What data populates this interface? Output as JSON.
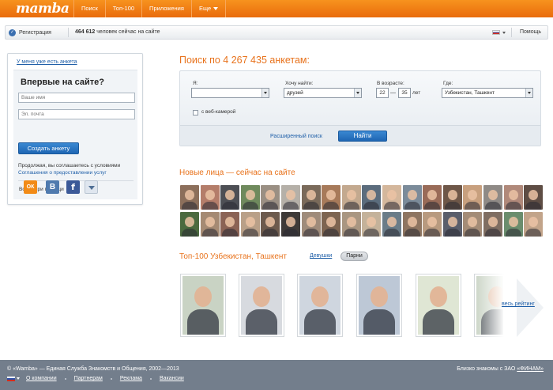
{
  "header": {
    "logo": "mamba",
    "nav": [
      {
        "label": "Поиск"
      },
      {
        "label": "Топ-100"
      },
      {
        "label": "Приложения"
      },
      {
        "label": "Еще"
      }
    ]
  },
  "subbar": {
    "registration": "Регистрация",
    "online_count": "464 612",
    "online_text": " человек сейчас на сайте",
    "help": "Помощь"
  },
  "login": {
    "have_account": "У меня уже есть анкета",
    "title": "Впервые на сайте?",
    "name_placeholder": "Ваше имя",
    "email_placeholder": "Эл. почта",
    "create_button": "Создать анкету",
    "terms_text": "Продолжая, вы соглашаетесь с условиями",
    "terms_link": "Соглашения о предоставлении услуг",
    "login_with": "Войти при помощи",
    "social": {
      "ok": "ОК",
      "vk": "B",
      "fb": "f"
    }
  },
  "search": {
    "title": "Поиск по 4 267 435 анкетам:",
    "i_label": "Я:",
    "i_value": "",
    "want_label": "Хочу найти:",
    "want_value": "друзей",
    "age_label": "В возрасте:",
    "age_from": "22",
    "age_dash": "—",
    "age_to": "35",
    "age_unit": "лет",
    "where_label": "Где:",
    "where_value": "Узбекистан, Ташкент",
    "webcam_label": "с веб-камерой",
    "advanced": "Расширенный поиск",
    "find_button": "Найти"
  },
  "faces": {
    "title": "Новые лица — сейчас на сайте",
    "colors": [
      "#8c6f5b",
      "#b47d6a",
      "#4d4f55",
      "#6f8a5d",
      "#9a8f83",
      "#b5b0a8",
      "#7a6a5a",
      "#a77a5a",
      "#c3a98f",
      "#5b6c7d",
      "#d4b79c",
      "#7b8b9a",
      "#996b58",
      "#6e5748",
      "#c8a07e",
      "#8f8a86",
      "#b0897a",
      "#5e4d44",
      "#4b6a3f",
      "#a58a73",
      "#8b6355",
      "#b9a088",
      "#6c5a4d",
      "#3e3a38",
      "#9f8b7a",
      "#7d6450",
      "#a99681",
      "#c4b29a",
      "#6a7c88",
      "#8e7561",
      "#b89a7f",
      "#5a5e6b",
      "#a48c77",
      "#7f6e62",
      "#6a8d6d",
      "#c2a48a"
    ]
  },
  "top100": {
    "title": "Топ-100 Узбекистан, Ташкент",
    "tab_girls": "Девушки",
    "tab_guys": "Парни",
    "full_rating": "весь рейтинг",
    "photo_colors": [
      "#c9d3c4",
      "#d7dadf",
      "#cfd6df",
      "#bdc8d6",
      "#dfe6d4"
    ]
  },
  "footer": {
    "copyright": "© «Wamba» — Единая Служба Знакомств и Общения, 2002—2013",
    "links": [
      "О компании",
      "Партнерам",
      "Реклама",
      "Вакансии"
    ],
    "finam_text": "Близко знакомы с ЗАО ",
    "finam_link": "«ФИНАМ»"
  }
}
